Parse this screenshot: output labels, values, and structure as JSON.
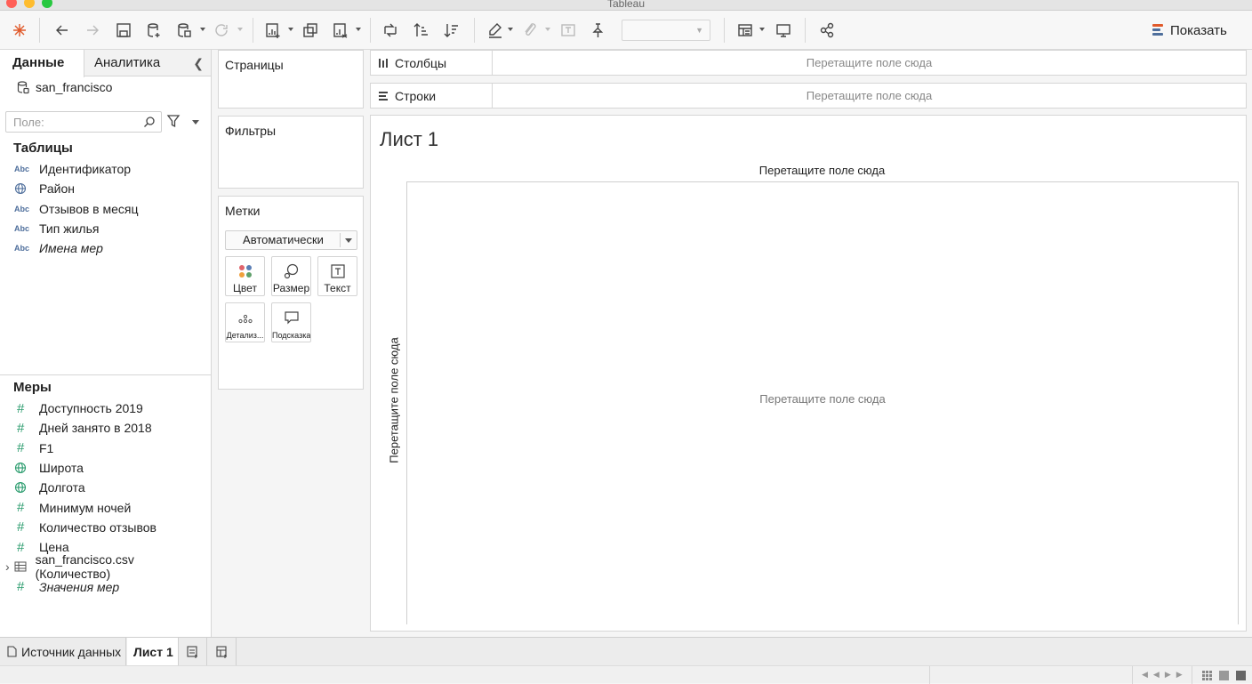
{
  "app": {
    "title": "Tableau"
  },
  "toolbar": {
    "show_label": "Показать",
    "dropdown_value": ""
  },
  "data_pane": {
    "tab_data": "Данные",
    "tab_analytics": "Аналитика",
    "datasource": "san_francisco",
    "search_placeholder": "Поле:",
    "tables_title": "Таблицы",
    "dimensions": [
      {
        "type": "Abc",
        "label": "Идентификатор"
      },
      {
        "type": "globe",
        "label": "Район"
      },
      {
        "type": "Abc",
        "label": "Отзывов в месяц"
      },
      {
        "type": "Abc",
        "label": "Тип жилья"
      },
      {
        "type": "Abc",
        "label": "Имена мер"
      }
    ],
    "measures_title": "Меры",
    "measures": [
      {
        "type": "#",
        "label": "Доступность 2019"
      },
      {
        "type": "#",
        "label": "Дней занято в 2018"
      },
      {
        "type": "#",
        "label": "F1"
      },
      {
        "type": "globe",
        "label": "Широта"
      },
      {
        "type": "globe",
        "label": "Долгота"
      },
      {
        "type": "#",
        "label": "Минимум ночей"
      },
      {
        "type": "#",
        "label": "Количество отзывов"
      },
      {
        "type": "#",
        "label": "Цена"
      },
      {
        "type": "table",
        "label": "san_francisco.csv (Количество)"
      },
      {
        "type": "#",
        "label": "Значения мер"
      }
    ]
  },
  "cards": {
    "pages": "Страницы",
    "filters": "Фильтры",
    "marks": "Метки",
    "marks_type": "Автоматически",
    "marks_buttons": {
      "color": "Цвет",
      "size": "Размер",
      "text": "Текст",
      "detail": "Детализ...",
      "tooltip": "Подсказка"
    }
  },
  "shelves": {
    "columns": "Столбцы",
    "rows": "Строки",
    "drop_hint": "Перетащите поле сюда"
  },
  "sheet": {
    "title": "Лист 1",
    "drop_hint": "Перетащите поле сюда"
  },
  "bottom_tabs": {
    "data_source": "Источник данных",
    "sheet": "Лист 1"
  },
  "colors": {
    "abc": "#4f6f9c",
    "measure": "#2b9c6e",
    "accent": "#e05a2b"
  }
}
